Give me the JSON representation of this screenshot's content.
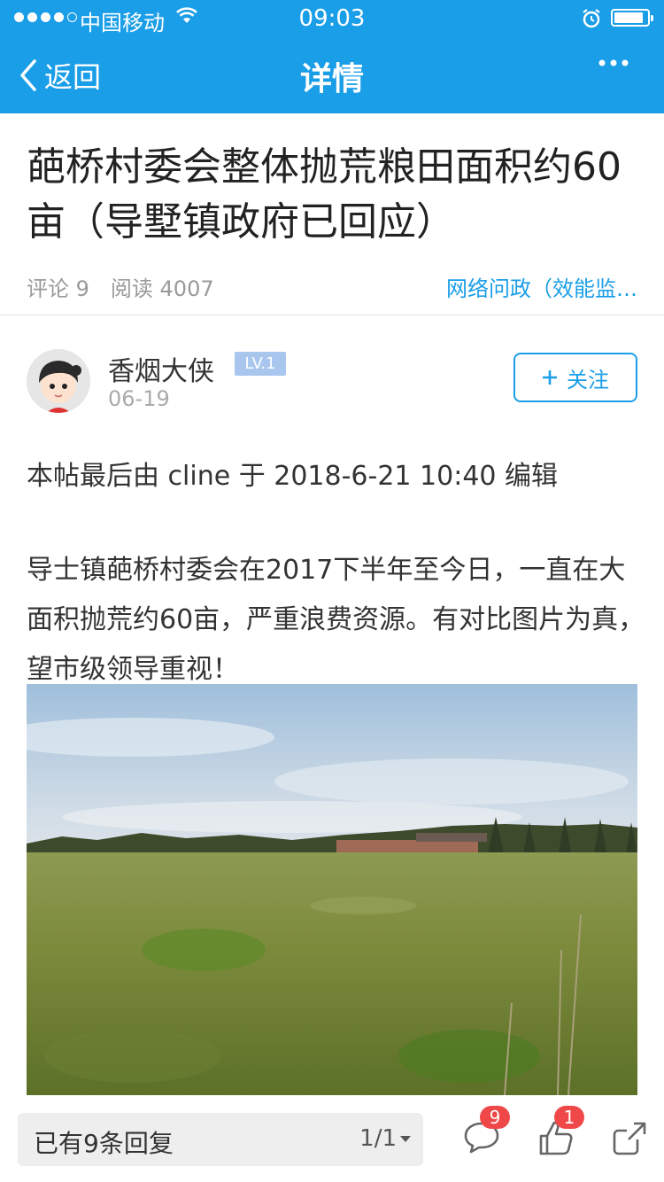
{
  "status_bar": {
    "carrier": "中国移动",
    "time": "09:03",
    "battery_level": 0.9
  },
  "nav": {
    "back_label": "返回",
    "title": "详情"
  },
  "post": {
    "title": "葩桥村委会整体抛荒粮田面积约60亩（导墅镇政府已回应）",
    "comments": "评论 9",
    "views": "阅读 4007",
    "forum": "网络问政（效能监…"
  },
  "author": {
    "name": "香烟大侠",
    "level": "LV.1",
    "date": "06-19",
    "follow_label": "关注"
  },
  "content": {
    "edit_note": "本帖最后由 cline 于 2018-6-21 10:40 编辑",
    "paragraph": "导士镇葩桥村委会在2017下半年至今日，一直在大面积抛荒约60亩，严重浪费资源。有对比图片为真，望市级领导重视！"
  },
  "bottom_bar": {
    "reply_text": "已有9条回复",
    "page": "1/1",
    "comment_badge": "9",
    "like_badge": "1"
  },
  "colors": {
    "brand": "#1a9ee8",
    "badge": "#f04848"
  }
}
